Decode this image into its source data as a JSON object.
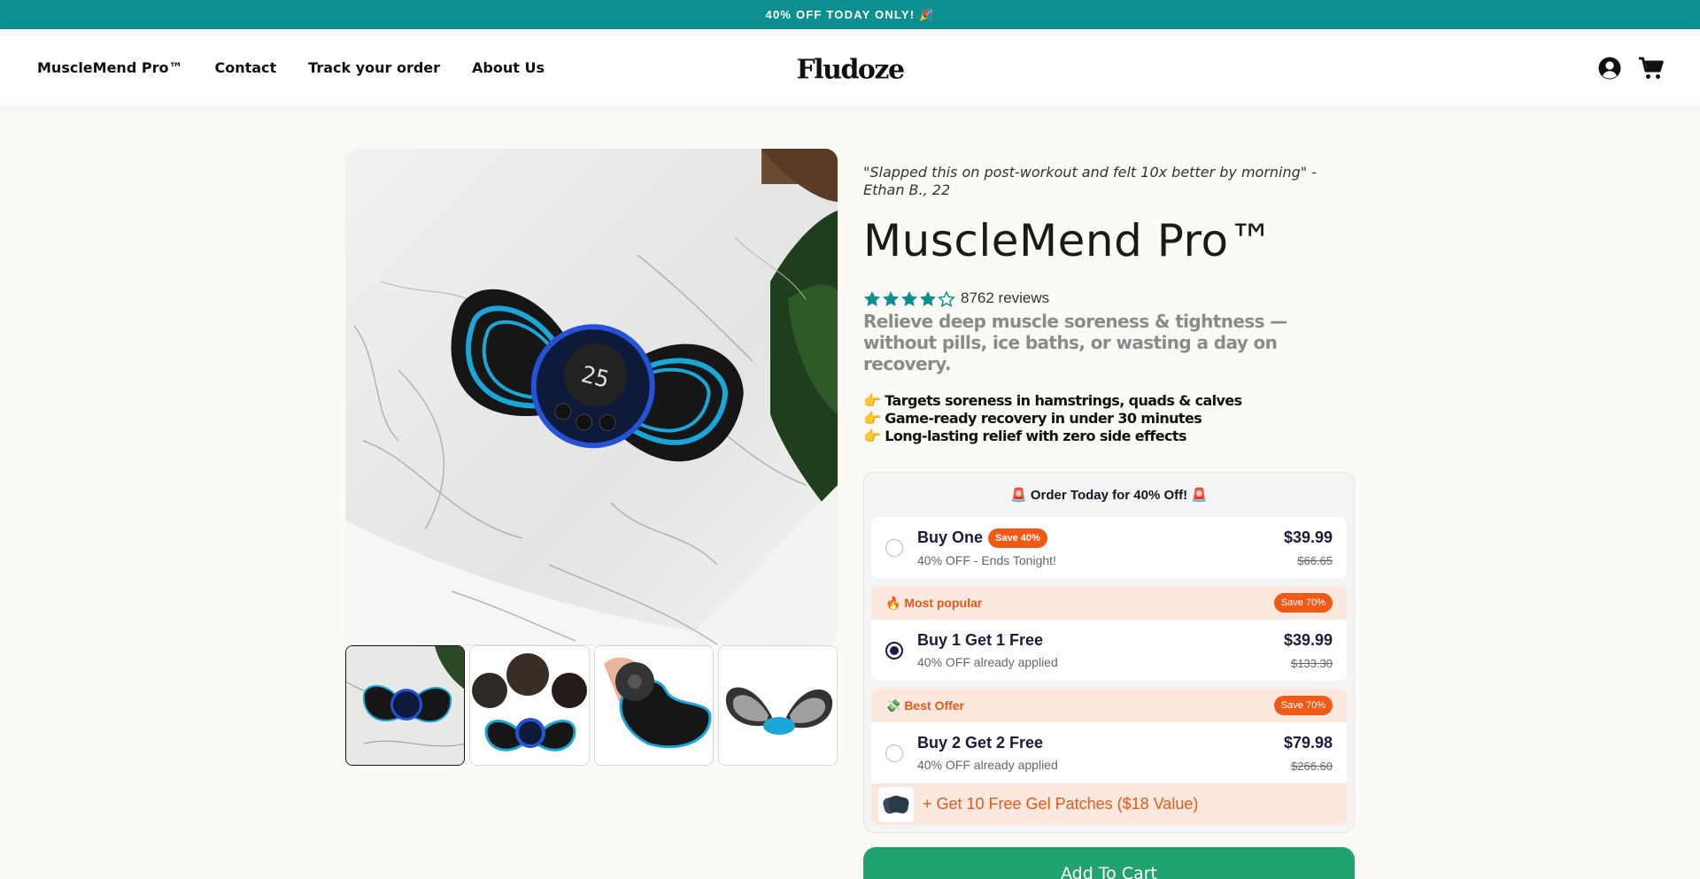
{
  "announcement": {
    "text": "40% OFF TODAY ONLY! 🎉"
  },
  "header": {
    "nav": [
      {
        "label": "MuscleMend Pro™"
      },
      {
        "label": "Contact"
      },
      {
        "label": "Track your order"
      },
      {
        "label": "About Us"
      }
    ],
    "logo": "Fludoze",
    "icons": [
      "account-icon",
      "cart-icon"
    ]
  },
  "product": {
    "testimonial": "\"Slapped this on post-workout and felt 10x better by morning\" - Ethan B., 22",
    "title": "MuscleMend Pro™",
    "rating": 4.5,
    "reviews_text": "8762 reviews",
    "subhead": "Relieve deep muscle soreness & tightness — without pills, ice baths, or wasting a day on recovery.",
    "bullets": [
      "👉 Targets soreness in hamstrings, quads & calves",
      "👉 Game-ready recovery in under 30 minutes",
      "👉 Long-lasting relief with zero side effects"
    ],
    "colors": {
      "accent": "#0e8f8f",
      "cta": "#21a36f",
      "badge": "#f15a16"
    }
  },
  "offers": {
    "header": "🚨 Order Today for 40% Off! 🚨",
    "options": [
      {
        "title": "Buy One",
        "badge": "Save 40%",
        "subtitle": "40% OFF - Ends Tonight!",
        "price": "$39.99",
        "compare_price": "$66.65",
        "selected": false
      },
      {
        "tag": "🔥 Most popular",
        "tag_badge": "Save 70%",
        "title": "Buy 1 Get 1 Free",
        "subtitle": "40% OFF already applied",
        "price": "$39.99",
        "compare_price": "$133.30",
        "selected": true
      },
      {
        "tag": "💸 Best Offer",
        "tag_badge": "Save 70%",
        "title": "Buy 2 Get 2 Free",
        "subtitle": "40% OFF already applied",
        "price": "$79.98",
        "compare_price": "$266.60",
        "selected": false
      }
    ],
    "gift": "+ Get 10 Free Gel Patches ($18 Value)"
  },
  "cta": {
    "label": "Add To Cart"
  }
}
